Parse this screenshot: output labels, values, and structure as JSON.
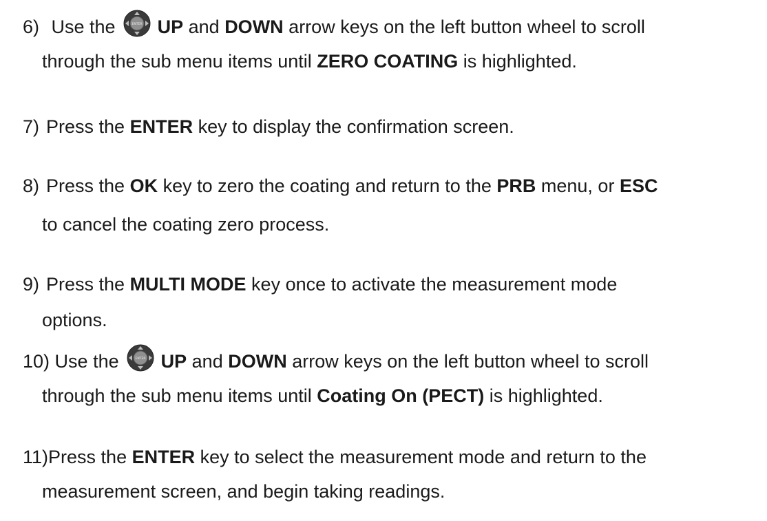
{
  "steps": [
    {
      "number": "6)",
      "pre_icon": "Use the",
      "icon": "enter-wheel-icon",
      "k1": "UP",
      "t1": " and ",
      "k2": "DOWN",
      "t2": " arrow keys on the left button wheel to scroll",
      "line2_pre": "through the sub menu items until ",
      "line2_key": "ZERO COATING",
      "line2_post": " is highlighted."
    },
    {
      "number": "7)",
      "t1": "Press the ",
      "k1": "ENTER",
      "t2": " key to display the confirmation screen."
    },
    {
      "number": "8)",
      "t1": "Press the ",
      "k1": "OK",
      "t2": " key to zero the coating and return to the ",
      "k2": "PRB",
      "t3": " menu, or ",
      "k3": "ESC",
      "line2": "to cancel the coating zero process."
    },
    {
      "number": "9)",
      "t1": "Press the ",
      "k1": "MULTI MODE",
      "t2": " key once to activate the measurement mode",
      "line2": "options."
    },
    {
      "number": "10)",
      "pre_icon": "Use the",
      "icon": "enter-wheel-icon",
      "k1": "UP",
      "t1": " and ",
      "k2": "DOWN",
      "t2": " arrow keys on the left button wheel to scroll",
      "line2_pre": "through the sub menu items until ",
      "line2_key": "Coating On (PECT)",
      "line2_post": " is highlighted."
    },
    {
      "number": "11)",
      "t1": "Press the ",
      "k1": "ENTER",
      "t2": " key to select the measurement mode and return to the",
      "line2": "measurement screen, and begin taking readings."
    }
  ],
  "icon_label": "ENTER",
  "colors": {
    "text": "#1a1a1a",
    "wheel_dark": "#3a3a3a",
    "wheel_light": "#9a9a9a"
  }
}
